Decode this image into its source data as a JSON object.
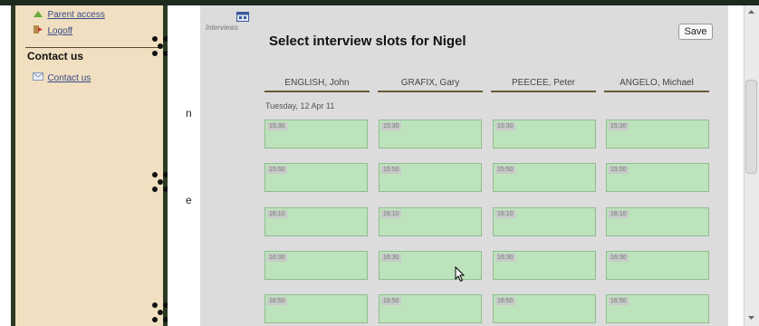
{
  "sidebar": {
    "parent_access_label": "Parent access",
    "logoff_label": "Logoff",
    "contact_heading": "Contact us",
    "contact_link_label": "Contact us"
  },
  "edge_text": {
    "letter_1": "n",
    "letter_2": "e"
  },
  "main": {
    "section_label": "Interviews",
    "title": "Select interview slots for Nigel",
    "save_label": "Save",
    "columns": [
      "ENGLISH, John",
      "GRAFIX, Gary",
      "PEECEE, Peter",
      "ANGELO, Michael"
    ],
    "date": "Tuesday, 12 Apr 11",
    "times": [
      "15:30",
      "15:50",
      "16:10",
      "16:30",
      "16:50"
    ]
  },
  "colors": {
    "slot_fill": "#bde3bd",
    "panel_bg": "#dcdcdc",
    "sidebar_bg": "#f0dfc0"
  }
}
